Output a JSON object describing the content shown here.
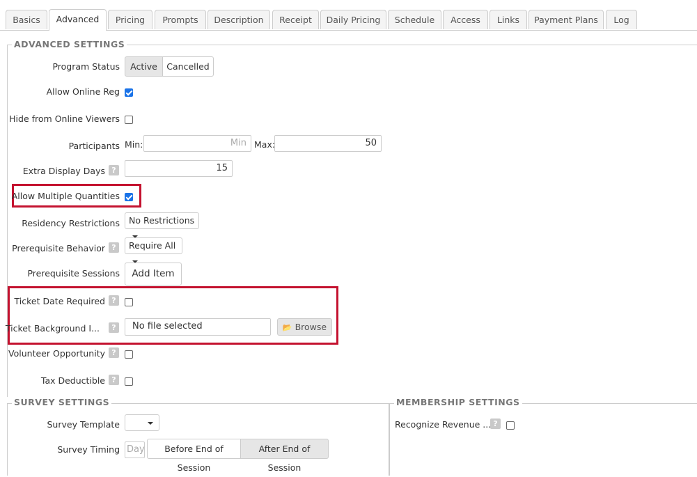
{
  "tabs": [
    "Basics",
    "Advanced",
    "Pricing",
    "Prompts",
    "Description",
    "Receipt",
    "Daily Pricing",
    "Schedule",
    "Access",
    "Links",
    "Payment Plans",
    "Log"
  ],
  "active_tab": "Advanced",
  "advanced": {
    "legend": "ADVANCED SETTINGS",
    "program_status": {
      "label": "Program Status",
      "options": [
        "Active",
        "Cancelled"
      ],
      "selected": "Active"
    },
    "allow_online_reg": {
      "label": "Allow Online Reg",
      "checked": true
    },
    "hide_online_viewers": {
      "label": "Hide from Online Viewers",
      "checked": false
    },
    "participants": {
      "label": "Participants",
      "min_label": "Min:",
      "min_placeholder": "Min",
      "max_label": "Max:",
      "max_value": "50"
    },
    "extra_display_days": {
      "label": "Extra Display Days",
      "value": "15"
    },
    "allow_multiple_quantities": {
      "label": "Allow Multiple Quantities",
      "checked": true
    },
    "residency_restrictions": {
      "label": "Residency Restrictions",
      "value": "No Restrictions"
    },
    "prerequisite_behavior": {
      "label": "Prerequisite Behavior",
      "value": "Require All"
    },
    "prerequisite_sessions": {
      "label": "Prerequisite Sessions",
      "button": "Add Item"
    },
    "ticket_date_required": {
      "label": "Ticket Date Required",
      "checked": false
    },
    "ticket_background": {
      "label": "Ticket Background I...",
      "file_text": "No file selected",
      "browse": "Browse"
    },
    "volunteer_opportunity": {
      "label": "Volunteer Opportunity",
      "checked": false
    },
    "tax_deductible": {
      "label": "Tax Deductible",
      "checked": false
    }
  },
  "survey": {
    "legend": "SURVEY SETTINGS",
    "template_label": "Survey Template",
    "timing_label": "Survey Timing",
    "day_placeholder": "Day",
    "timing_options": [
      "Before End of Session",
      "After End of Session"
    ],
    "timing_selected": "After End of Session"
  },
  "membership": {
    "legend": "MEMBERSHIP SETTINGS",
    "recognize_label": "Recognize Revenue ...",
    "checked": false
  },
  "help_glyph": "?",
  "accent_highlight": "#c4122f"
}
